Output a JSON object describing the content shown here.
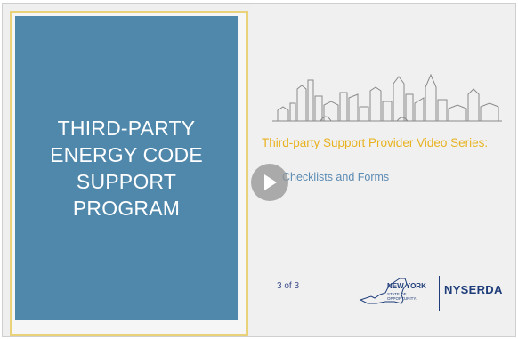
{
  "slide": {
    "title": "THIRD-PARTY ENERGY CODE SUPPORT PROGRAM",
    "series_title": "Third-party Support Provider Video Series:",
    "subtitle": "Checklists and Forms",
    "page_indicator": "3 of 3"
  },
  "branding": {
    "state_logo_line1": "NEW YORK",
    "state_logo_line2": "STATE OF OPPORTUNITY.",
    "org_name": "NYSERDA"
  },
  "player": {
    "play_icon": "play-icon"
  },
  "colors": {
    "title_panel": "#5088ac",
    "frame_gold": "#e9d27a",
    "series_title": "#e8b21f",
    "subtitle": "#5b8bb3",
    "brand_navy": "#1f3d7a"
  }
}
